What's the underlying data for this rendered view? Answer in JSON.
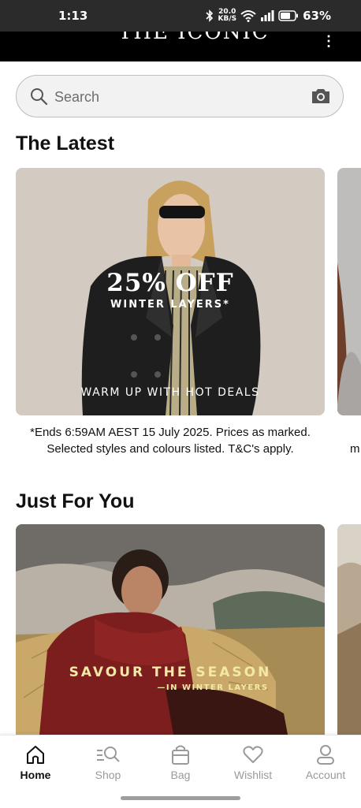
{
  "status_bar": {
    "time": "1:13",
    "net_speed_value": "20.0",
    "net_speed_unit": "KB/S",
    "battery": "63%"
  },
  "header": {
    "logo": "THE ICONIC",
    "menu_icon": "more-vertical-icon"
  },
  "search": {
    "placeholder": "Search",
    "camera_icon": "camera-icon"
  },
  "sections": {
    "latest": {
      "title": "The Latest",
      "promo": {
        "headline": "25% OFF",
        "subline": "WINTER LAYERS*",
        "footer": "WARM UP WITH HOT DEALS"
      },
      "caption": "*Ends 6:59AM AEST 15 July 2025. Prices as marked. Selected styles and colours listed. T&C's apply.",
      "next_caption_peek": "m"
    },
    "just_for_you": {
      "title": "Just For You",
      "promo": {
        "headline": "SAVOUR THE SEASON",
        "subline": "—IN WINTER LAYERS"
      }
    }
  },
  "bottom_nav": {
    "items": [
      {
        "label": "Home",
        "icon": "home-icon",
        "active": true
      },
      {
        "label": "Shop",
        "icon": "shop-search-icon",
        "active": false
      },
      {
        "label": "Bag",
        "icon": "bag-icon",
        "active": false
      },
      {
        "label": "Wishlist",
        "icon": "heart-icon",
        "active": false
      },
      {
        "label": "Account",
        "icon": "account-icon",
        "active": false
      }
    ]
  },
  "colors": {
    "status_bar_bg": "#2b2b2b",
    "header_bg": "#000000",
    "search_bg": "#f2f2f2",
    "nav_active": "#111111",
    "nav_inactive": "#9a9a9a",
    "promo_text_savour": "#f3e9a6"
  }
}
